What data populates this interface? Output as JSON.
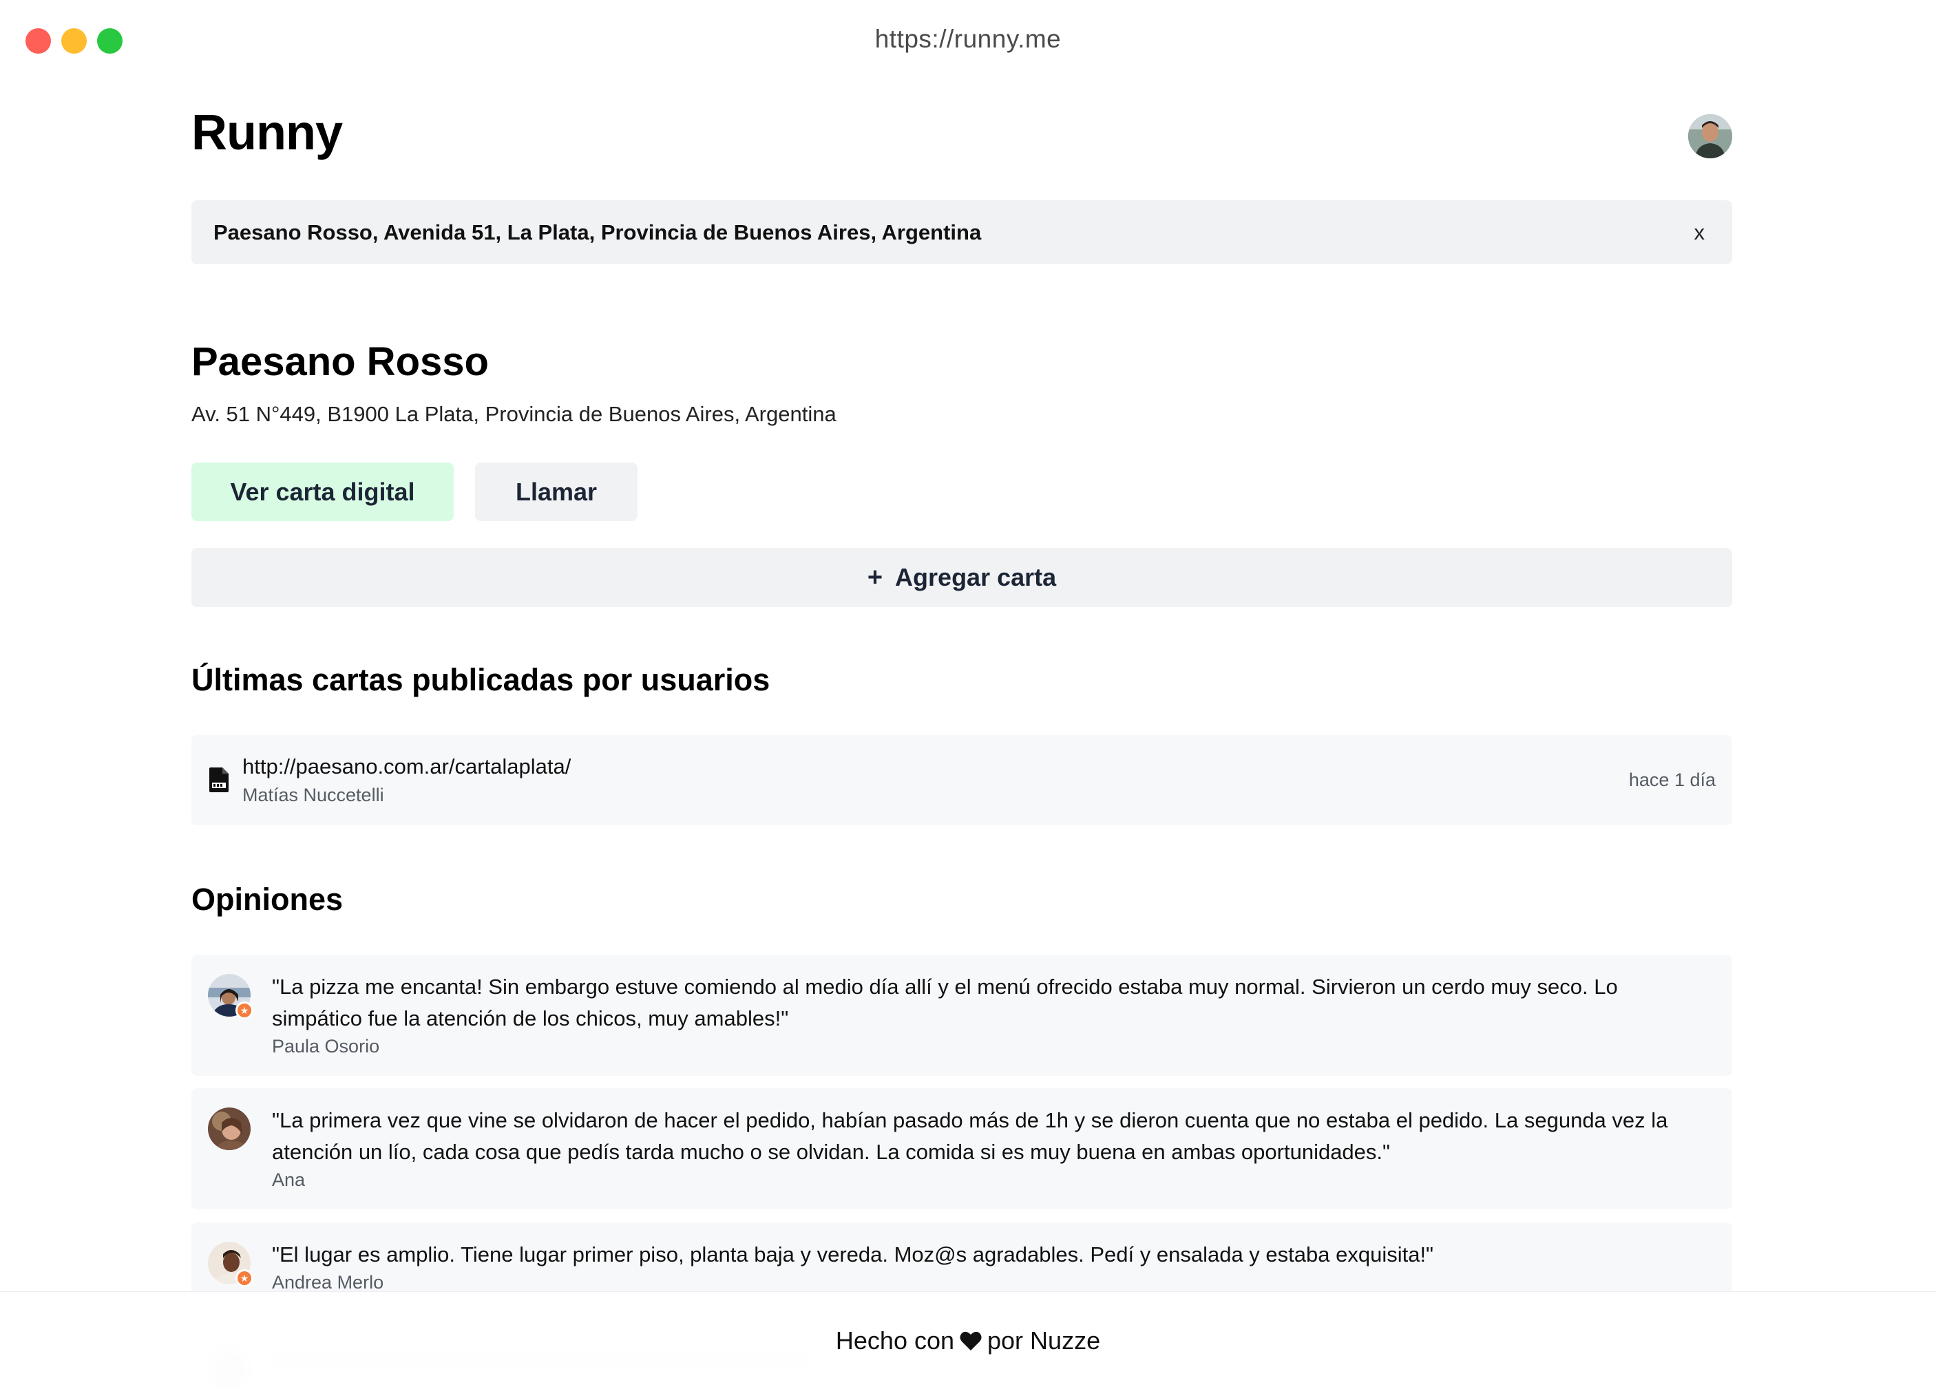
{
  "window": {
    "url": "https://runny.me"
  },
  "header": {
    "app_title": "Runny",
    "avatar_icon": "user-avatar"
  },
  "search": {
    "value": "Paesano Rosso, Avenida 51, La Plata, Provincia de Buenos Aires, Argentina",
    "clear_label": "x"
  },
  "place": {
    "name": "Paesano Rosso",
    "address": "Av. 51 N°449, B1900 La Plata, Provincia de Buenos Aires, Argentina"
  },
  "actions": {
    "view_menu_label": "Ver carta digital",
    "call_label": "Llamar",
    "add_menu_icon": "+",
    "add_menu_label": "Agregar carta"
  },
  "menus_section": {
    "title": "Últimas cartas publicadas por usuarios",
    "items": [
      {
        "icon": "pdf-file-icon",
        "url": "http://paesano.com.ar/cartalaplata/",
        "author": "Matías Nuccetelli",
        "time": "hace 1 día"
      }
    ]
  },
  "reviews_section": {
    "title": "Opiniones",
    "items": [
      {
        "text": "\"La pizza me encanta! Sin embargo estuve comiendo al medio día allí y el menú ofrecido estaba muy normal. Sirvieron un cerdo muy seco. Lo simpático fue la atención de los chicos, muy amables!\"",
        "author": "Paula Osorio"
      },
      {
        "text": "\"La primera vez que vine se olvidaron de hacer el pedido, habían pasado más de 1h y se dieron cuenta que no estaba el pedido. La segunda vez la atención un lío, cada cosa que pedís tarda mucho o se olvidan. La comida si es muy buena en ambas oportunidades.\"",
        "author": "Ana"
      },
      {
        "text": "\"El lugar es amplio. Tiene lugar primer piso, planta baja y vereda. Moz@s agradables. Pedí y ensalada y estaba exquisita!\"",
        "author": "Andrea Merlo"
      }
    ]
  },
  "footer": {
    "made_with": "Hecho con",
    "heart_icon": "heart-icon",
    "by": "por Nuzze"
  },
  "colors": {
    "primary_button_bg": "#d8fbe4",
    "secondary_button_bg": "#f1f2f4",
    "card_bg": "#f7f8fa",
    "badge": "#f47c3c"
  }
}
